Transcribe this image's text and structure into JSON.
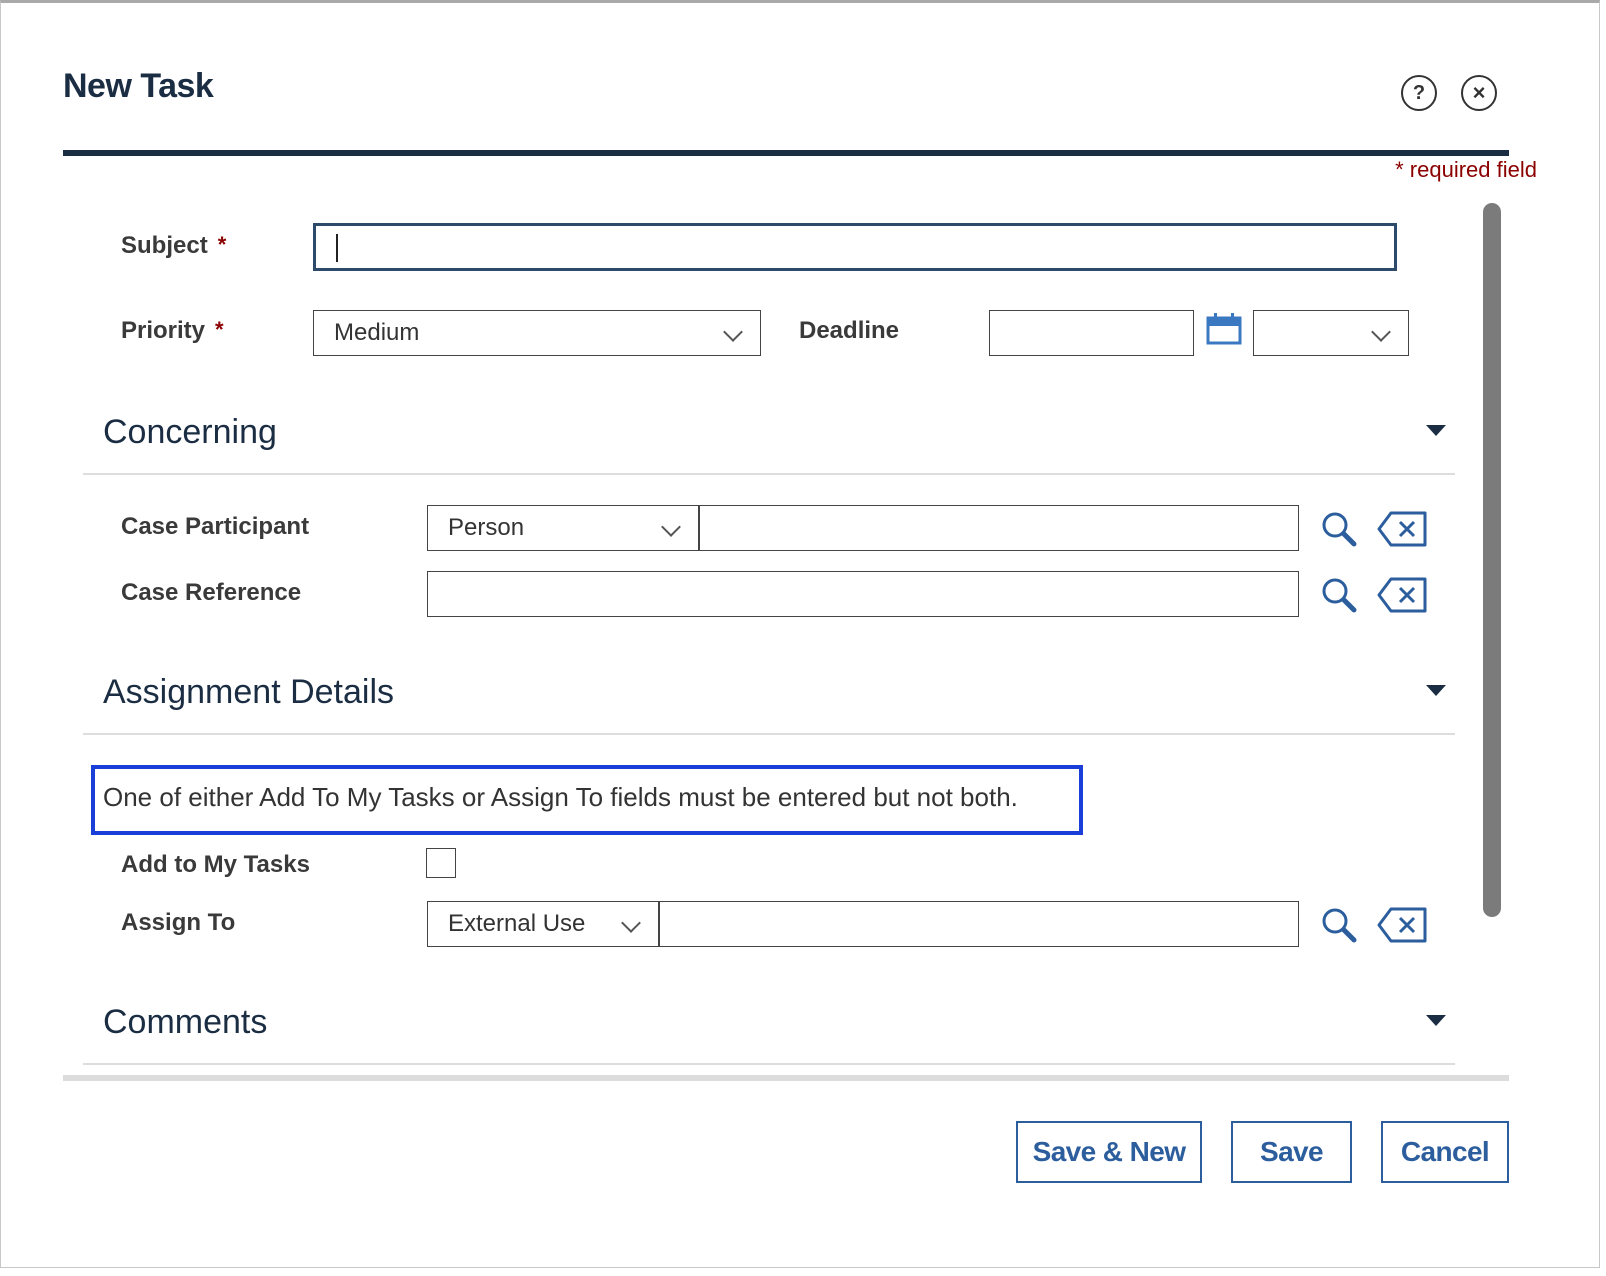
{
  "dialog": {
    "title": "New Task",
    "help_icon": "help-circle-icon",
    "close_icon": "close-circle-icon",
    "required_note": "* required field"
  },
  "fields": {
    "subject": {
      "label": "Subject",
      "required_mark": "*",
      "value": ""
    },
    "priority": {
      "label": "Priority",
      "required_mark": "*",
      "selected": "Medium"
    },
    "deadline": {
      "label": "Deadline",
      "date_value": "",
      "time_selected": ""
    }
  },
  "sections": {
    "concerning": {
      "title": "Concerning",
      "case_participant": {
        "label": "Case Participant",
        "type_selected": "Person",
        "value": ""
      },
      "case_reference": {
        "label": "Case Reference",
        "value": ""
      }
    },
    "assignment": {
      "title": "Assignment Details",
      "notice": "One of either Add To My Tasks or Assign To fields must be entered but not both.",
      "add_to_my_tasks": {
        "label": "Add to My Tasks",
        "checked": false
      },
      "assign_to": {
        "label": "Assign To",
        "type_selected": "External Use",
        "value": ""
      }
    },
    "comments": {
      "title": "Comments"
    }
  },
  "buttons": {
    "save_new": "Save & New",
    "save": "Save",
    "cancel": "Cancel"
  },
  "colors": {
    "title": "#1b2d43",
    "required": "#8b0000",
    "button": "#2c5e9e",
    "notice_border": "#1a3fd8",
    "calendar": "#3a78c2"
  }
}
